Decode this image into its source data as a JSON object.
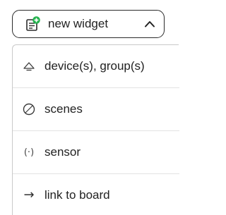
{
  "button": {
    "label": "new widget",
    "icon": "new-widget-plus-icon",
    "accent_color": "#22b14c",
    "chevron": "chevron-up-icon"
  },
  "menu": {
    "items": [
      {
        "label": "device(s), group(s)",
        "icon": "lamp-icon"
      },
      {
        "label": "scenes",
        "icon": "scenes-circle-icon"
      },
      {
        "label": "sensor",
        "icon": "sensor-icon",
        "glyph": "(·)"
      },
      {
        "label": "link to board",
        "icon": "arrow-right-icon",
        "glyph": "→"
      }
    ]
  }
}
